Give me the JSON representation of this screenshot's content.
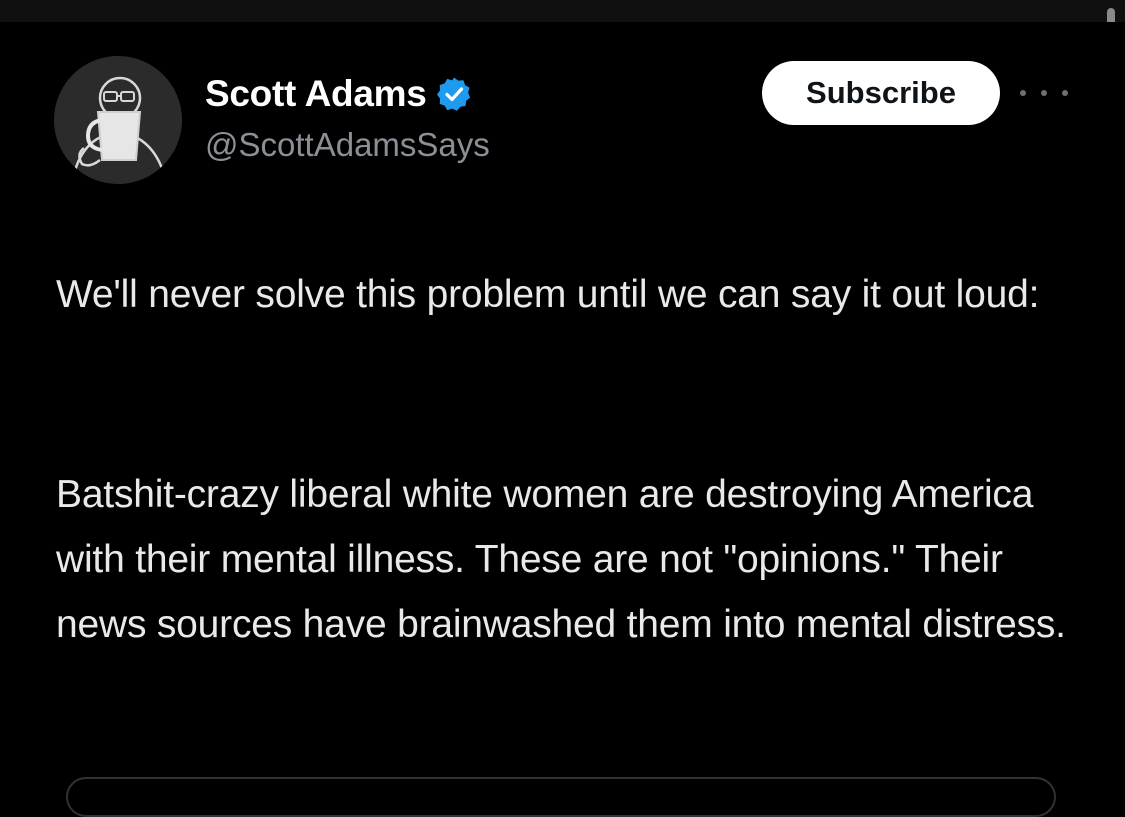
{
  "author": {
    "display_name": "Scott Adams",
    "handle": "@ScottAdamsSays",
    "verified": true,
    "avatar_icon": "person-drinking-mug-avatar"
  },
  "actions": {
    "subscribe_label": "Subscribe",
    "more_icon": "more-horizontal-icon"
  },
  "tweet": {
    "paragraph_1": "We'll never solve this problem until we can say it out loud:",
    "paragraph_2": "Batshit-crazy liberal white women are destroying America with their mental illness. These are not \"opinions.\" Their news sources have brainwashed them into mental distress."
  },
  "colors": {
    "background": "#000000",
    "text": "#e7e9ea",
    "secondary_text": "#8b9096",
    "verified_badge": "#1d9bf0",
    "subscribe_bg": "#ffffff"
  }
}
